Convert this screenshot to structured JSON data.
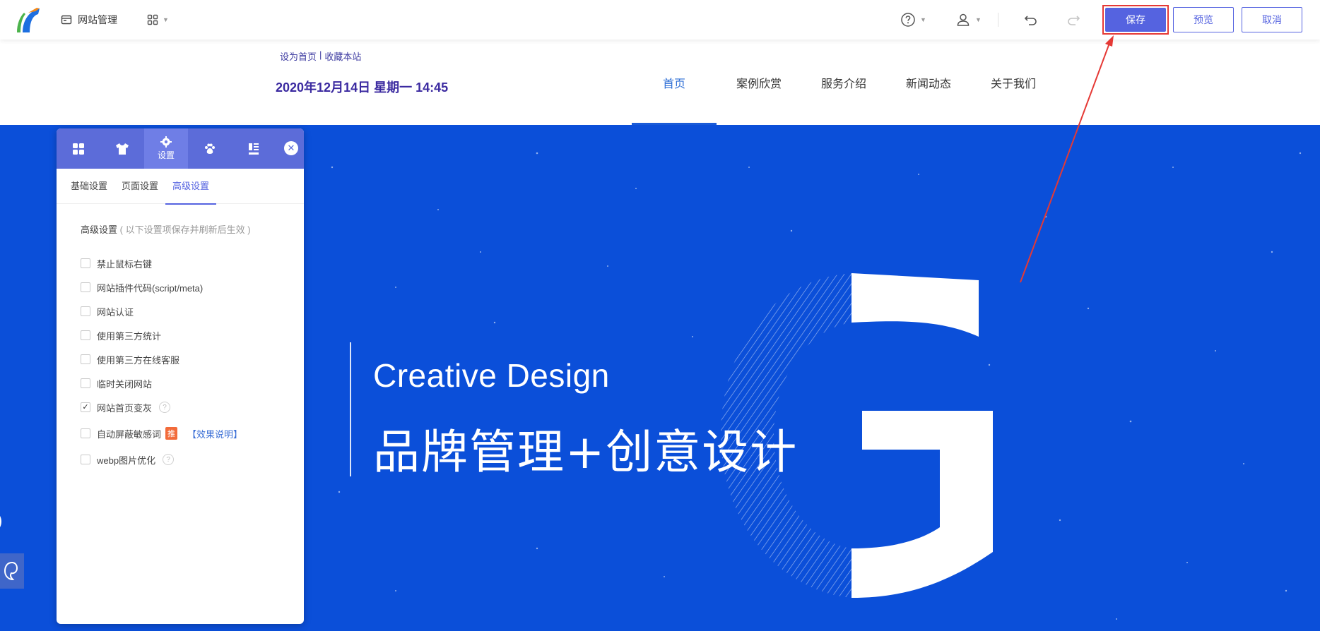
{
  "toolbar": {
    "site_manage_label": "网站管理",
    "save_label": "保存",
    "preview_label": "预览",
    "cancel_label": "取消",
    "icons": [
      "logo-icon",
      "site-icon",
      "apps-grid-icon",
      "help-icon",
      "user-icon",
      "undo-icon",
      "redo-icon"
    ],
    "accent_color": "#5563e0",
    "highlight_color": "#e53935"
  },
  "site": {
    "top_links": [
      "设为首页",
      "|",
      "收藏本站"
    ],
    "datetime": "2020年12月14日 星期一 14:45",
    "nav": [
      {
        "label": "首页",
        "active": true
      },
      {
        "label": "案例欣赏",
        "active": false
      },
      {
        "label": "服务介绍",
        "active": false
      },
      {
        "label": "新闻动态",
        "active": false
      },
      {
        "label": "关于我们",
        "active": false
      }
    ]
  },
  "hero": {
    "title_en": "Creative Design",
    "title_cn": "品牌管理+创意设计",
    "background_color": "#0b4fd9"
  },
  "panel": {
    "tabs": [
      {
        "icon": "grid-icon",
        "label": ""
      },
      {
        "icon": "shirt-icon",
        "label": ""
      },
      {
        "icon": "gear-icon",
        "label": "设置",
        "active": true
      },
      {
        "icon": "paw-icon",
        "label": ""
      },
      {
        "icon": "layout-icon",
        "label": ""
      }
    ],
    "subtabs": [
      "基础设置",
      "页面设置",
      "高级设置"
    ],
    "active_subtab": "高级设置",
    "section_title": "高级设置",
    "section_hint": "( 以下设置项保存并刷新后生效 )",
    "options": [
      {
        "label": "禁止鼠标右键",
        "checked": false
      },
      {
        "label": "网站插件代码(script/meta)",
        "checked": false
      },
      {
        "label": "网站认证",
        "checked": false
      },
      {
        "label": "使用第三方统计",
        "checked": false
      },
      {
        "label": "使用第三方在线客服",
        "checked": false
      },
      {
        "label": "临时关闭网站",
        "checked": false
      },
      {
        "label": "网站首页变灰",
        "checked": true,
        "help": "?"
      },
      {
        "label": "自动屏蔽敏感词",
        "checked": false,
        "badge": "推",
        "link": "【效果说明】"
      },
      {
        "label": "webp图片优化",
        "checked": false,
        "help": "?"
      }
    ]
  }
}
